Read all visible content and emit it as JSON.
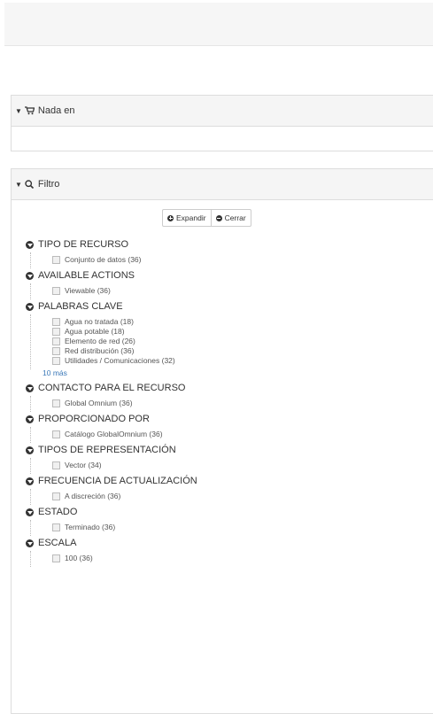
{
  "nada_en": {
    "title": "Nada en"
  },
  "filtro": {
    "title": "Filtro",
    "expand_label": "Expandir",
    "collapse_label": "Cerrar",
    "facets": [
      {
        "title": "TIPO DE RECURSO",
        "items": [
          "Conjunto de datos (36)"
        ]
      },
      {
        "title": "AVAILABLE ACTIONS",
        "items": [
          "Viewable (36)"
        ]
      },
      {
        "title": "PALABRAS CLAVE",
        "items": [
          "Agua no tratada (18)",
          "Agua potable (18)",
          "Elemento de red (26)",
          "Red distribución (36)",
          "Utilidades / Comunicaciones (32)"
        ],
        "more": "10 más"
      },
      {
        "title": "CONTACTO PARA EL RECURSO",
        "items": [
          "Global Omnium (36)"
        ]
      },
      {
        "title": "PROPORCIONADO POR",
        "items": [
          "Catálogo GlobalOmnium (36)"
        ]
      },
      {
        "title": "TIPOS DE REPRESENTACIÓN",
        "items": [
          "Vector (34)"
        ]
      },
      {
        "title": "FRECUENCIA DE ACTUALIZACIÓN",
        "items": [
          "A discreción (36)"
        ]
      },
      {
        "title": "ESTADO",
        "items": [
          "Terminado (36)"
        ]
      },
      {
        "title": "ESCALA",
        "items": [
          "100 (36)"
        ]
      }
    ]
  }
}
